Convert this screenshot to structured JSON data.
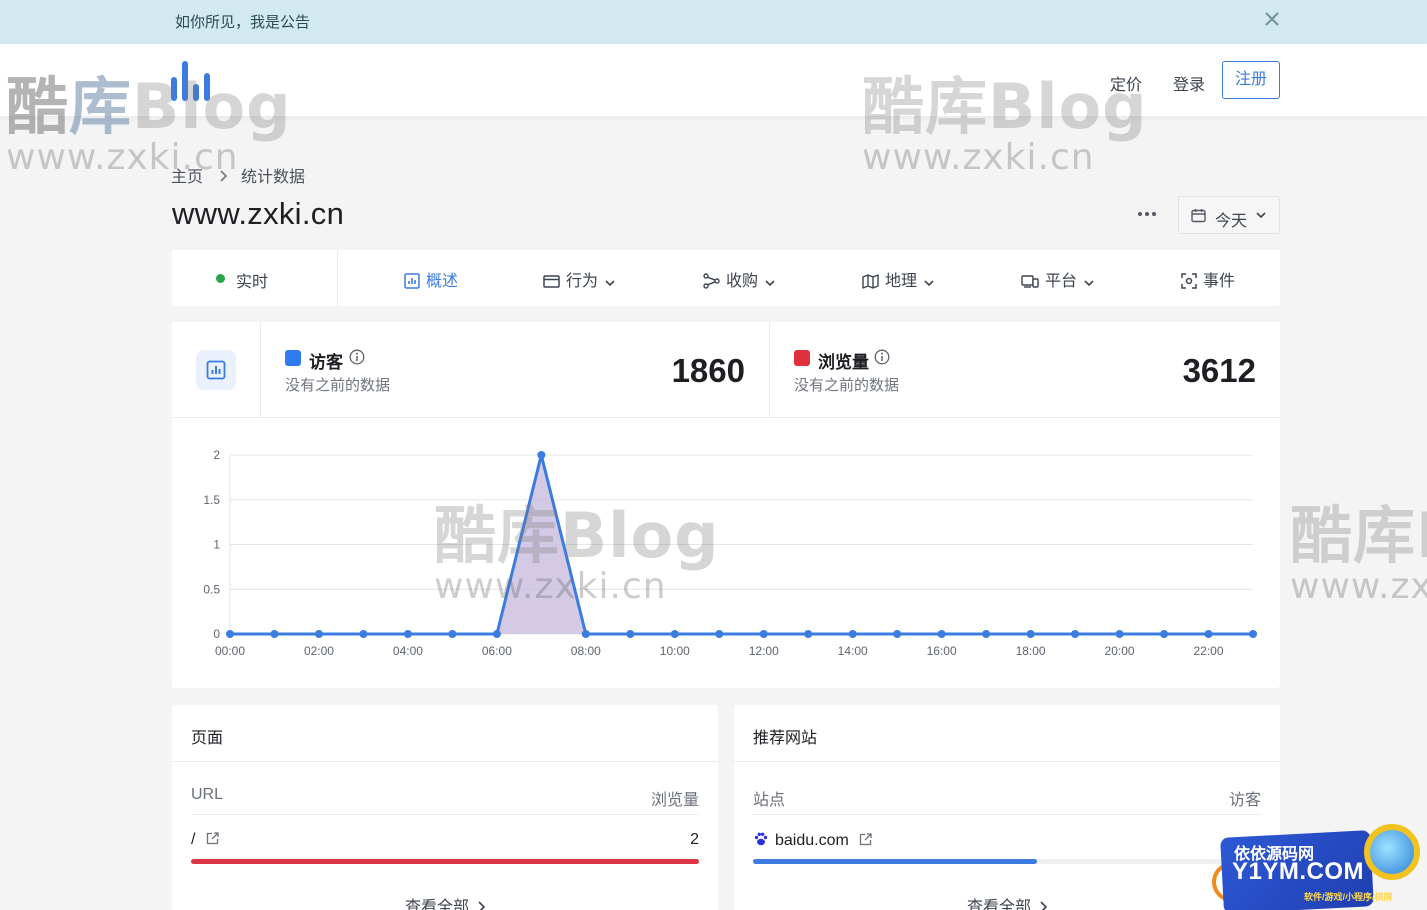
{
  "announcement": {
    "text": "如你所见，我是公告",
    "close_icon": "close-icon"
  },
  "header": {
    "logo_icon": "bar-chart-logo-icon",
    "nav": {
      "pricing": "定价",
      "login": "登录",
      "signup": "注册"
    },
    "accent_color": "#3c7ce0"
  },
  "breadcrumb": {
    "home": "主页",
    "current": "统计数据"
  },
  "site": {
    "title": "www.zxki.cn"
  },
  "date_picker": {
    "label": "今天"
  },
  "tabs": {
    "realtime": "实时",
    "overview": "概述",
    "behavior": "行为",
    "acquisition": "收购",
    "geography": "地理",
    "platform": "平台",
    "events": "事件",
    "active": "overview"
  },
  "metrics": {
    "visitors": {
      "label": "访客",
      "sub": "没有之前的数据",
      "value": "1860",
      "color": "#2e7cf0"
    },
    "pageviews": {
      "label": "浏览量",
      "sub": "没有之前的数据",
      "value": "3612",
      "color": "#e0303e"
    }
  },
  "chart_data": {
    "type": "line",
    "x": [
      "00:00",
      "01:00",
      "02:00",
      "03:00",
      "04:00",
      "05:00",
      "06:00",
      "07:00",
      "08:00",
      "09:00",
      "10:00",
      "11:00",
      "12:00",
      "13:00",
      "14:00",
      "15:00",
      "16:00",
      "17:00",
      "18:00",
      "19:00",
      "20:00",
      "21:00",
      "22:00",
      "23:00"
    ],
    "x_tick_labels": [
      "00:00",
      "02:00",
      "04:00",
      "06:00",
      "08:00",
      "10:00",
      "12:00",
      "14:00",
      "16:00",
      "18:00",
      "20:00",
      "22:00"
    ],
    "series": [
      {
        "values": [
          0,
          0,
          0,
          0,
          0,
          0,
          0,
          2,
          0,
          0,
          0,
          0,
          0,
          0,
          0,
          0,
          0,
          0,
          0,
          0,
          0,
          0,
          0,
          0
        ],
        "color": "#3c7ce0",
        "fill": "#c9bde0"
      }
    ],
    "y_ticks": [
      "0",
      "0.5",
      "1",
      "1.5",
      "2"
    ],
    "ylim": [
      0,
      2
    ],
    "grid": true
  },
  "pages_panel": {
    "title": "页面",
    "col_left": "URL",
    "col_right": "浏览量",
    "rows": [
      {
        "label": "/",
        "value": "2",
        "share": 1.0,
        "color": "#dc3545"
      }
    ],
    "view_all": "查看全部"
  },
  "referrers_panel": {
    "title": "推荐网站",
    "col_left": "站点",
    "col_right": "访客",
    "rows": [
      {
        "label": "baidu.com",
        "value": "",
        "share": 0.56,
        "color": "#3c7ce0"
      }
    ],
    "view_all": "查看全部"
  },
  "watermark": {
    "brand": "酷库Blog",
    "url": "www.zxki.cn"
  },
  "corner_badge": {
    "line1": "依依源码网",
    "line2": "Y1YM.COM",
    "line3": "软件/游戏/小程序/棋牌"
  }
}
